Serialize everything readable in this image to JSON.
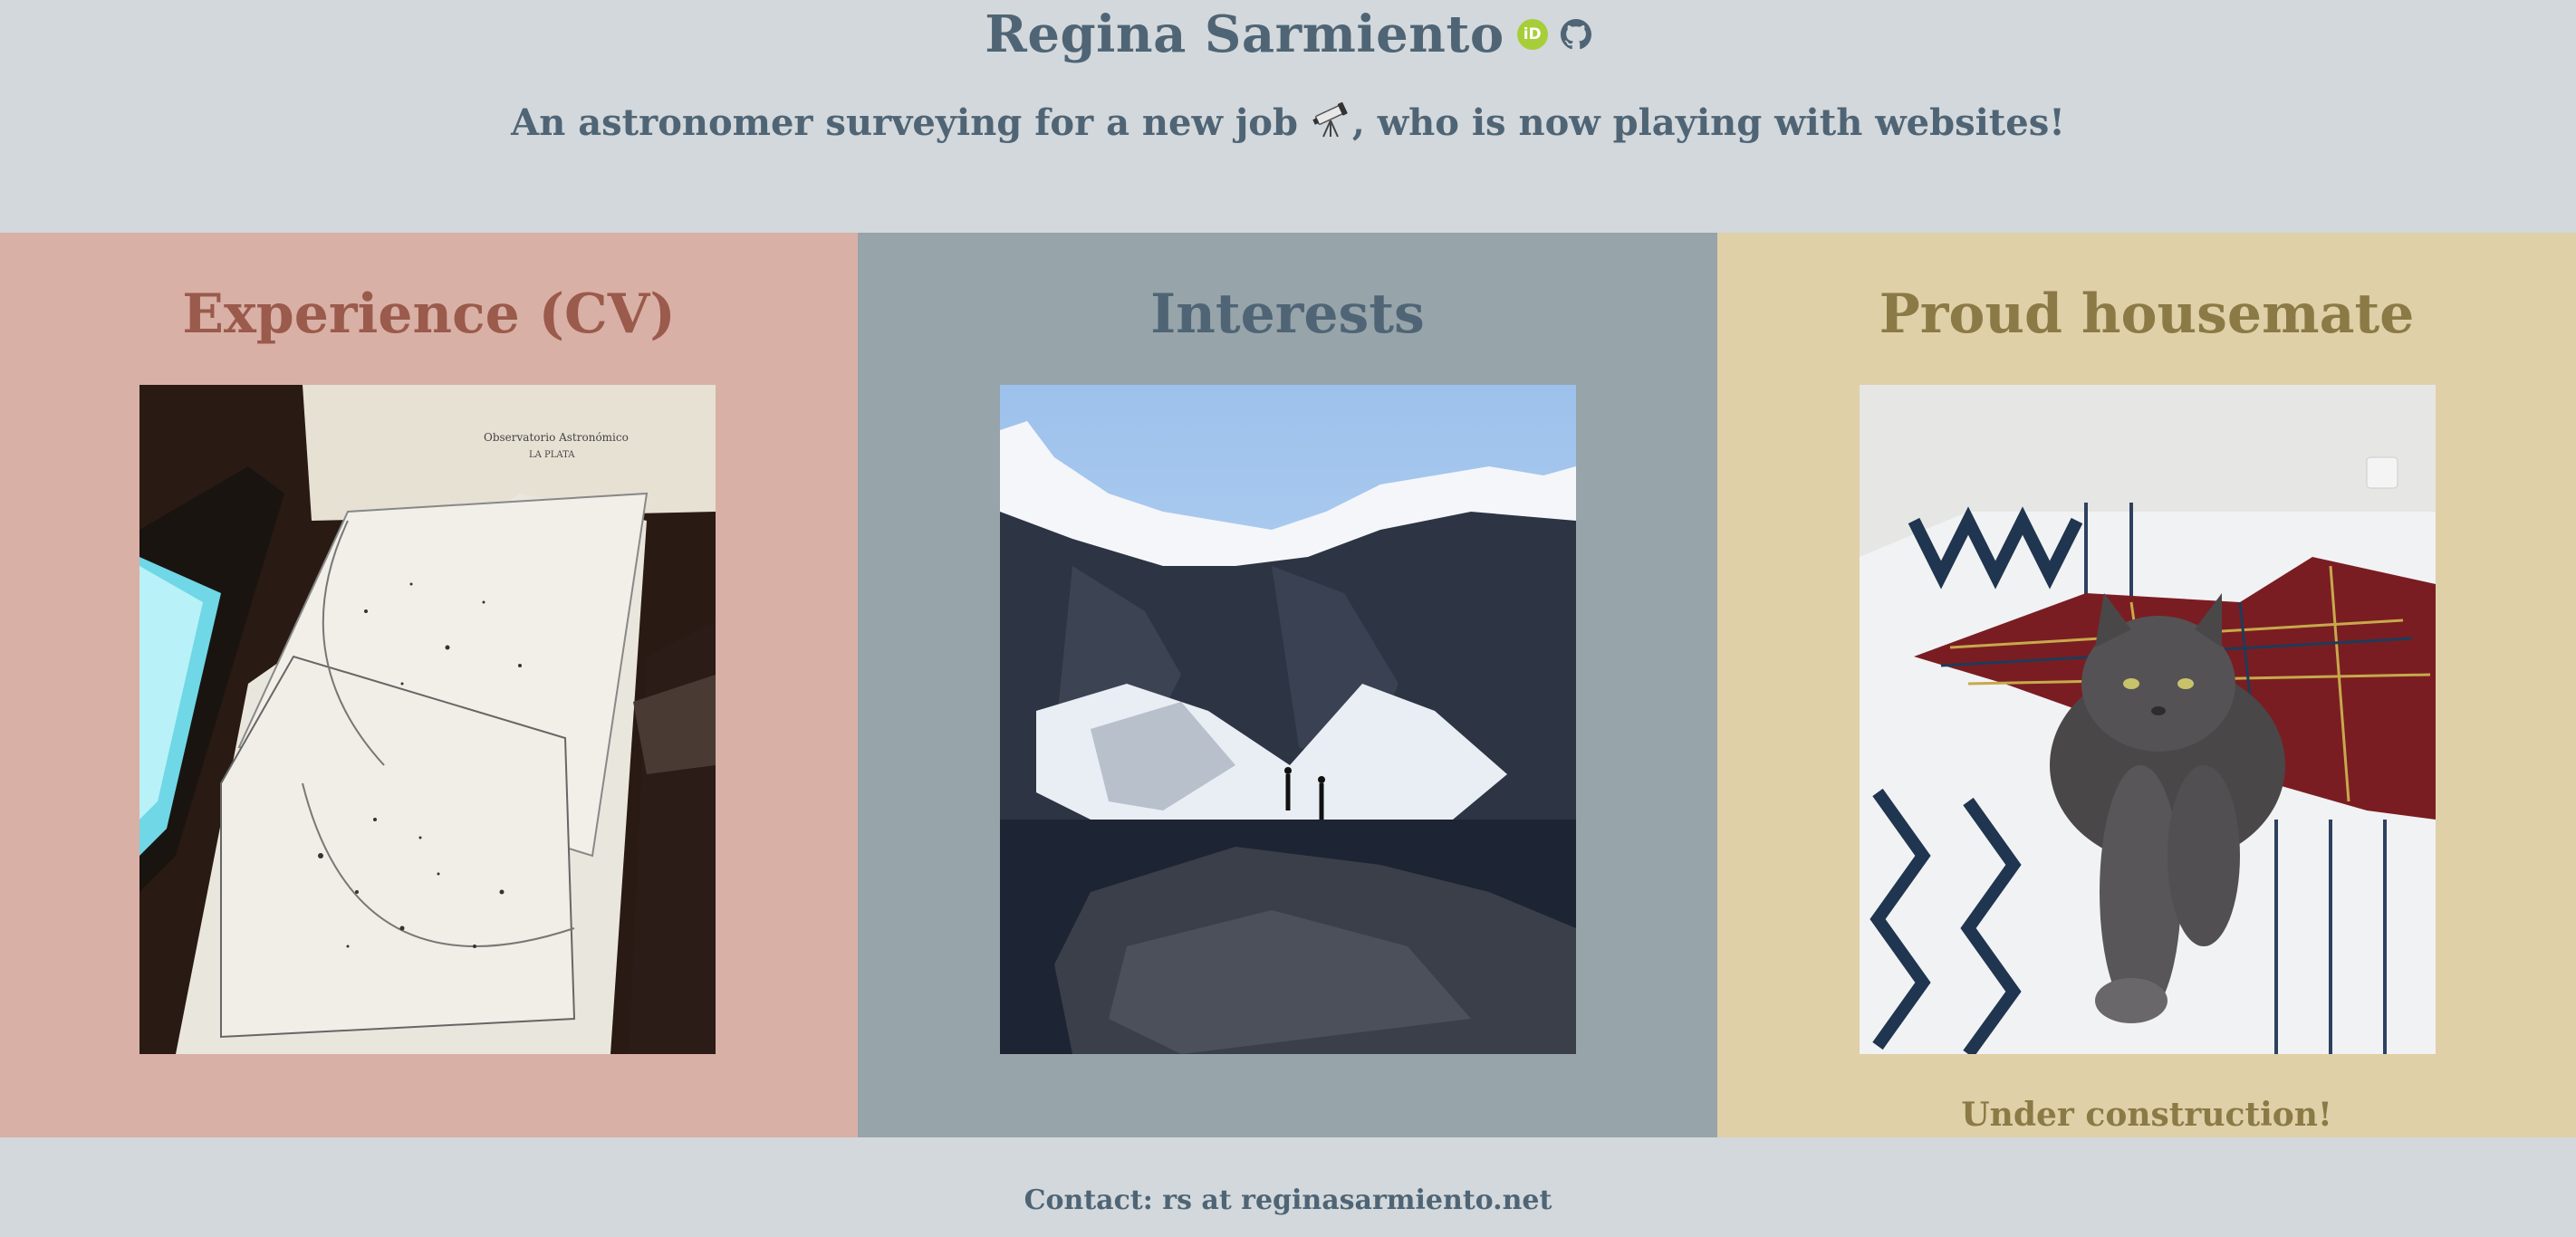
{
  "header": {
    "title": "Regina Sarmiento",
    "orcid_icon": "orcid-icon",
    "orcid_text": "iD",
    "github_icon": "github-icon",
    "tagline_before": "An astronomer surveying for a new job",
    "tagline_icon": "telescope-icon",
    "tagline_after": ", who is now playing with websites!"
  },
  "sections": [
    {
      "title": "Experience (CV)",
      "image": "star-charts-photo"
    },
    {
      "title": "Interests",
      "image": "mountain-lake-photo"
    },
    {
      "title": "Proud housemate",
      "image": "cat-photo",
      "note": "Under construction!"
    }
  ],
  "footer": {
    "contact": "Contact: rs at reginasarmiento.net"
  },
  "colors": {
    "background": "#d3d8dc",
    "cv_panel": "#d9b0a5",
    "interests_panel": "#97a4aa",
    "housemate_panel": "#dfd0a8",
    "text": "#4f6575",
    "orcid": "#a6ce39"
  }
}
